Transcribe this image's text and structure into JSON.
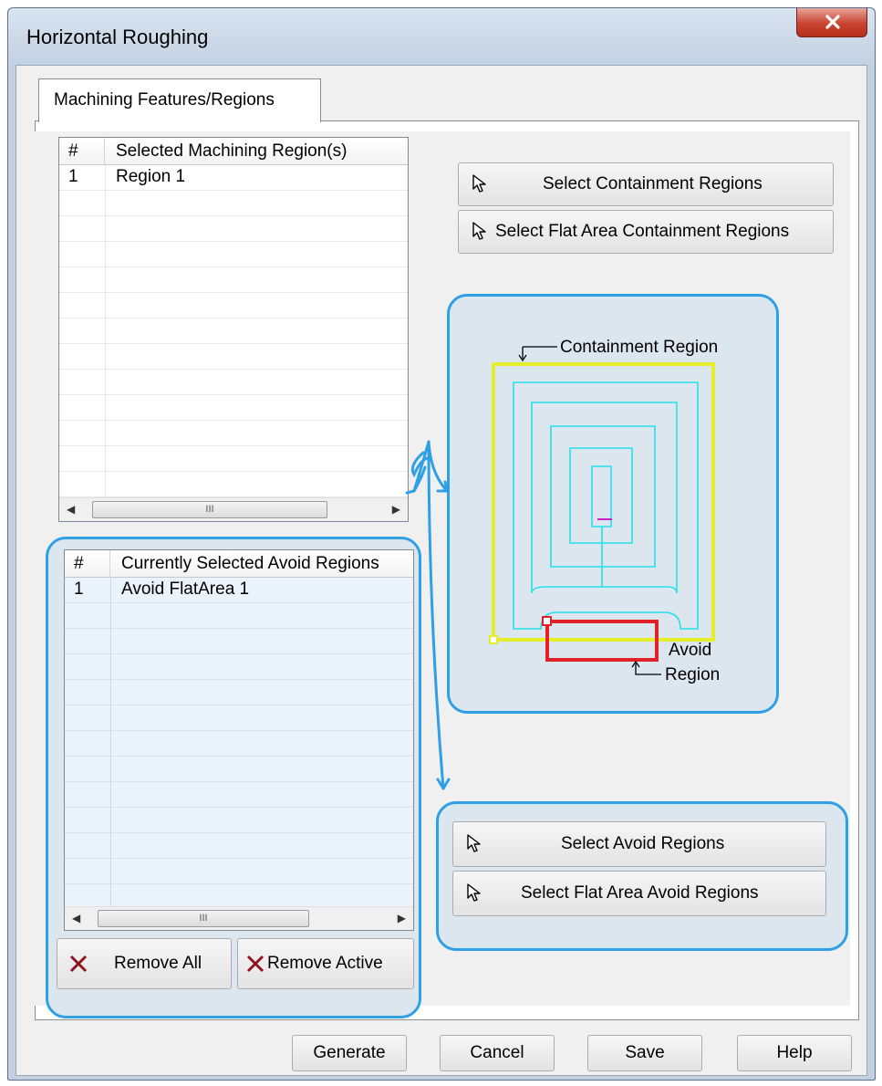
{
  "window": {
    "title": "Horizontal Roughing",
    "close_glyph": "x"
  },
  "tab": {
    "label": "Machining Features/Regions"
  },
  "machining_list": {
    "col_hash": "#",
    "col_title": "Selected Machining Region(s)",
    "rows": [
      {
        "num": "1",
        "name": "Region 1"
      }
    ],
    "scroll_glyph": "III"
  },
  "avoid_list": {
    "col_hash": "#",
    "col_title": "Currently Selected Avoid Regions",
    "rows": [
      {
        "num": "1",
        "name": "Avoid FlatArea 1"
      }
    ],
    "scroll_glyph": "III"
  },
  "buttons": {
    "select_containment": "Select Containment Regions",
    "select_flat_containment": "Select Flat Area Containment Regions",
    "select_avoid": "Select Avoid Regions",
    "select_flat_avoid": "Select Flat Area Avoid Regions",
    "remove_all": "Remove All",
    "remove_active": "Remove Active",
    "generate": "Generate",
    "cancel": "Cancel",
    "save": "Save",
    "help": "Help"
  },
  "diagram": {
    "containment_label": "Containment Region",
    "avoid_label_1": "Avoid",
    "avoid_label_2": "Region"
  },
  "colors": {
    "accent_frame": "#2fa0e6",
    "containment": "#e6ee2a",
    "toolpath": "#26e0e8",
    "avoid": "#e2202a"
  },
  "icons": [
    "close-icon",
    "pointer-icon",
    "remove-icon"
  ]
}
